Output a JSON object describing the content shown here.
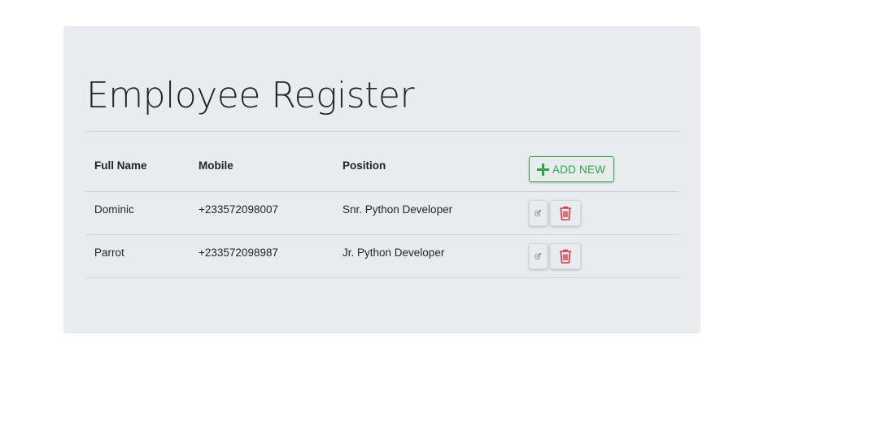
{
  "page": {
    "title": "Employee Register"
  },
  "table": {
    "headers": {
      "full_name": "Full Name",
      "mobile": "Mobile",
      "position": "Position"
    },
    "add_button_label": "ADD NEW",
    "rows": [
      {
        "full_name": "Dominic",
        "mobile": "+233572098007",
        "position": "Snr. Python Developer"
      },
      {
        "full_name": "Parrot",
        "mobile": "+233572098987",
        "position": "Jr. Python Developer"
      }
    ]
  },
  "icons": {
    "add": "plus-icon",
    "edit": "pencil-square-icon",
    "delete": "trash-icon"
  },
  "colors": {
    "success": "#28a745",
    "danger": "#dc3545",
    "muted": "#6c757d",
    "panel_background": "#e9ecef"
  }
}
